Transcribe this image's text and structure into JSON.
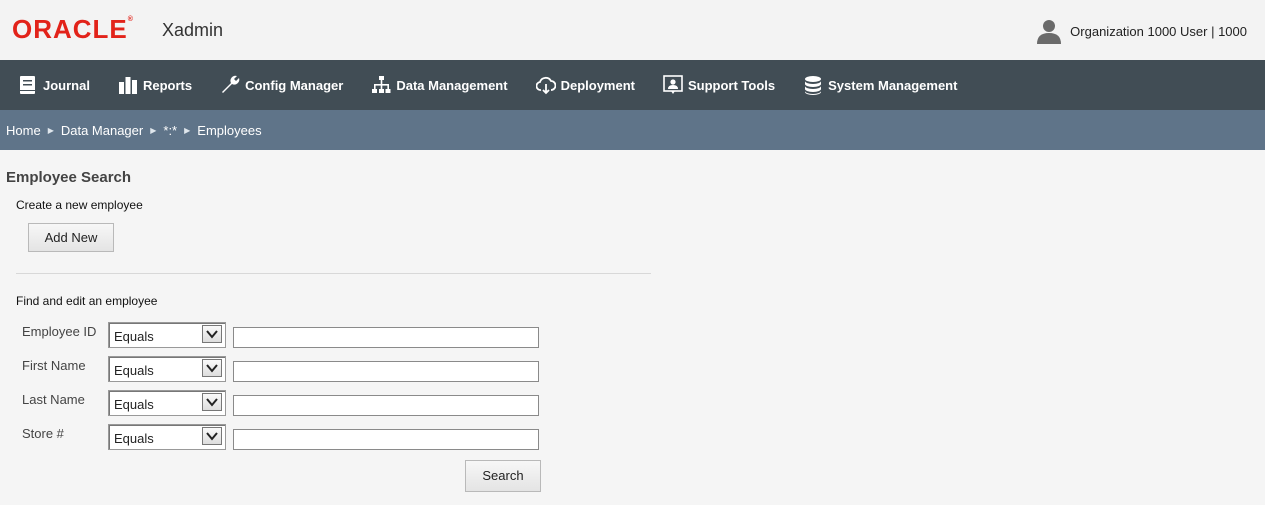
{
  "header": {
    "brand": "ORACLE",
    "app_name": "Xadmin",
    "user_label": "Organization 1000 User | 1000"
  },
  "nav": {
    "items": [
      {
        "label": "Journal",
        "icon": "book-icon"
      },
      {
        "label": "Reports",
        "icon": "bar-chart-icon"
      },
      {
        "label": "Config Manager",
        "icon": "wrench-icon"
      },
      {
        "label": "Data Management",
        "icon": "sitemap-icon"
      },
      {
        "label": "Deployment",
        "icon": "cloud-download-icon"
      },
      {
        "label": "Support Tools",
        "icon": "support-person-icon"
      },
      {
        "label": "System Management",
        "icon": "database-icon"
      }
    ]
  },
  "breadcrumb": [
    "Home",
    "Data Manager",
    "*:*",
    "Employees"
  ],
  "page": {
    "title": "Employee Search",
    "create_label": "Create a new employee",
    "add_new": "Add New",
    "find_label": "Find and edit an employee",
    "fields": [
      {
        "label": "Employee ID",
        "operator": "Equals",
        "value": ""
      },
      {
        "label": "First Name",
        "operator": "Equals",
        "value": ""
      },
      {
        "label": "Last Name",
        "operator": "Equals",
        "value": ""
      },
      {
        "label": "Store #",
        "operator": "Equals",
        "value": ""
      }
    ],
    "search": "Search"
  },
  "colors": {
    "brand": "#e2231a",
    "navbar": "#414d55",
    "breadcrumb_bar": "#5f7489"
  }
}
